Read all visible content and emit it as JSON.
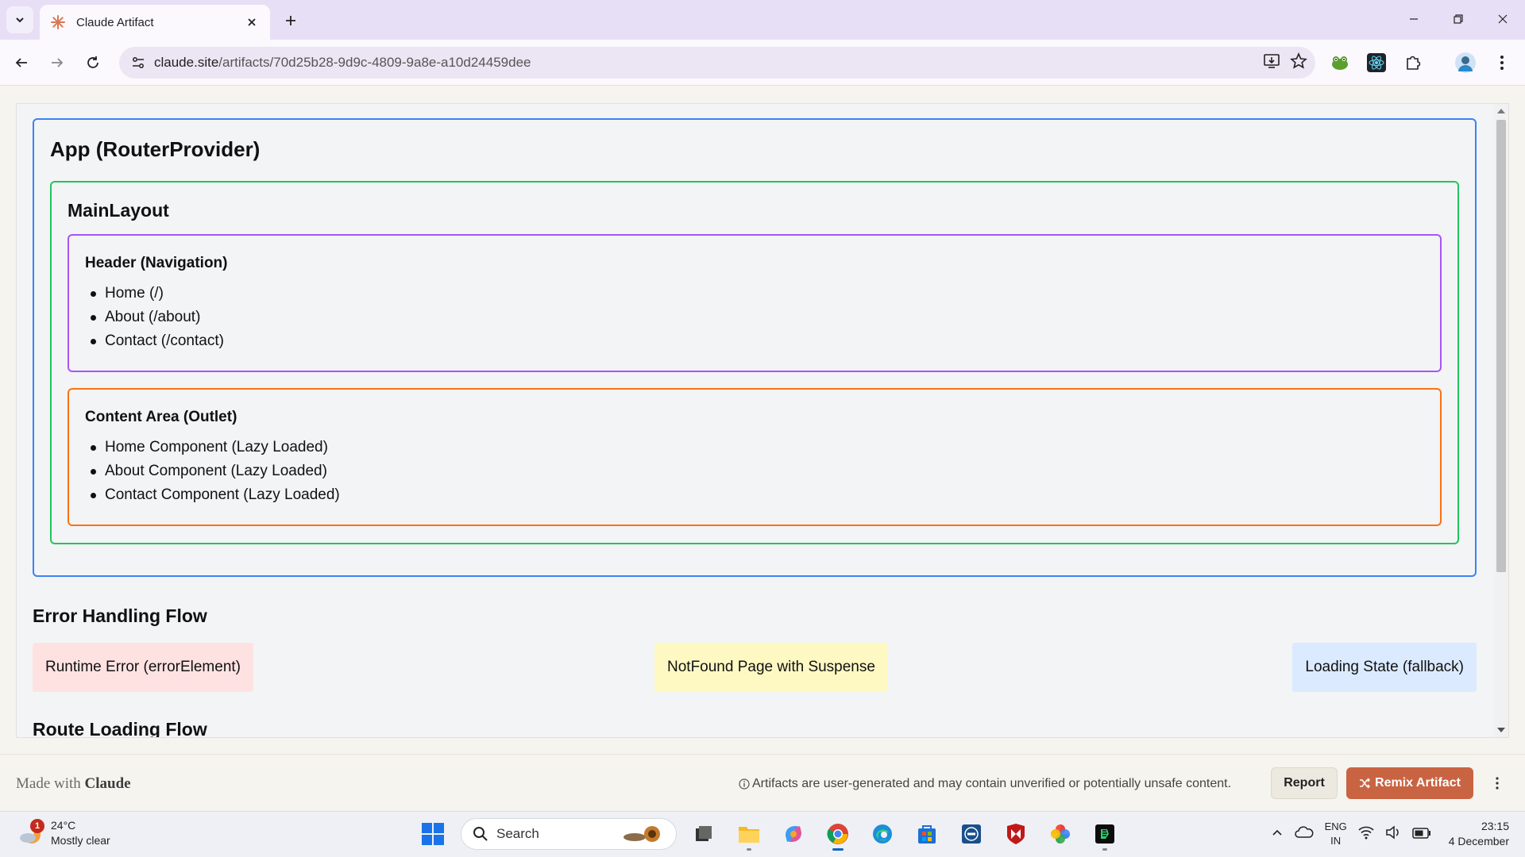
{
  "browser": {
    "tab_title": "Claude Artifact",
    "url_host": "claude.site",
    "url_path": "/artifacts/70d25b28-9d9c-4809-9a8e-a10d24459dee"
  },
  "artifact": {
    "app_title": "App (RouterProvider)",
    "main_layout_title": "MainLayout",
    "header_box": {
      "title": "Header (Navigation)",
      "items": [
        "Home (/)",
        "About (/about)",
        "Contact (/contact)"
      ]
    },
    "outlet_box": {
      "title": "Content Area (Outlet)",
      "items": [
        "Home Component (Lazy Loaded)",
        "About Component (Lazy Loaded)",
        "Contact Component (Lazy Loaded)"
      ]
    },
    "error_section_title": "Error Handling Flow",
    "error_chips": [
      "Runtime Error (errorElement)",
      "NotFound Page with Suspense",
      "Loading State (fallback)"
    ],
    "route_section_title": "Route Loading Flow"
  },
  "footer": {
    "made_with": "Made with",
    "brand": "Claude",
    "disclaimer": "Artifacts are user-generated and may contain unverified or potentially unsafe content.",
    "report_label": "Report",
    "remix_label": "Remix Artifact"
  },
  "taskbar": {
    "weather_badge": "1",
    "temperature": "24°C",
    "condition": "Mostly clear",
    "search_placeholder": "Search",
    "lang_top": "ENG",
    "lang_bottom": "IN",
    "time": "23:15",
    "date": "4 December"
  },
  "colors": {
    "app_border": "#3b82f6",
    "main_border": "#22c55e",
    "header_border": "#a855f7",
    "outlet_border": "#f97316",
    "remix_button": "#c96442"
  }
}
